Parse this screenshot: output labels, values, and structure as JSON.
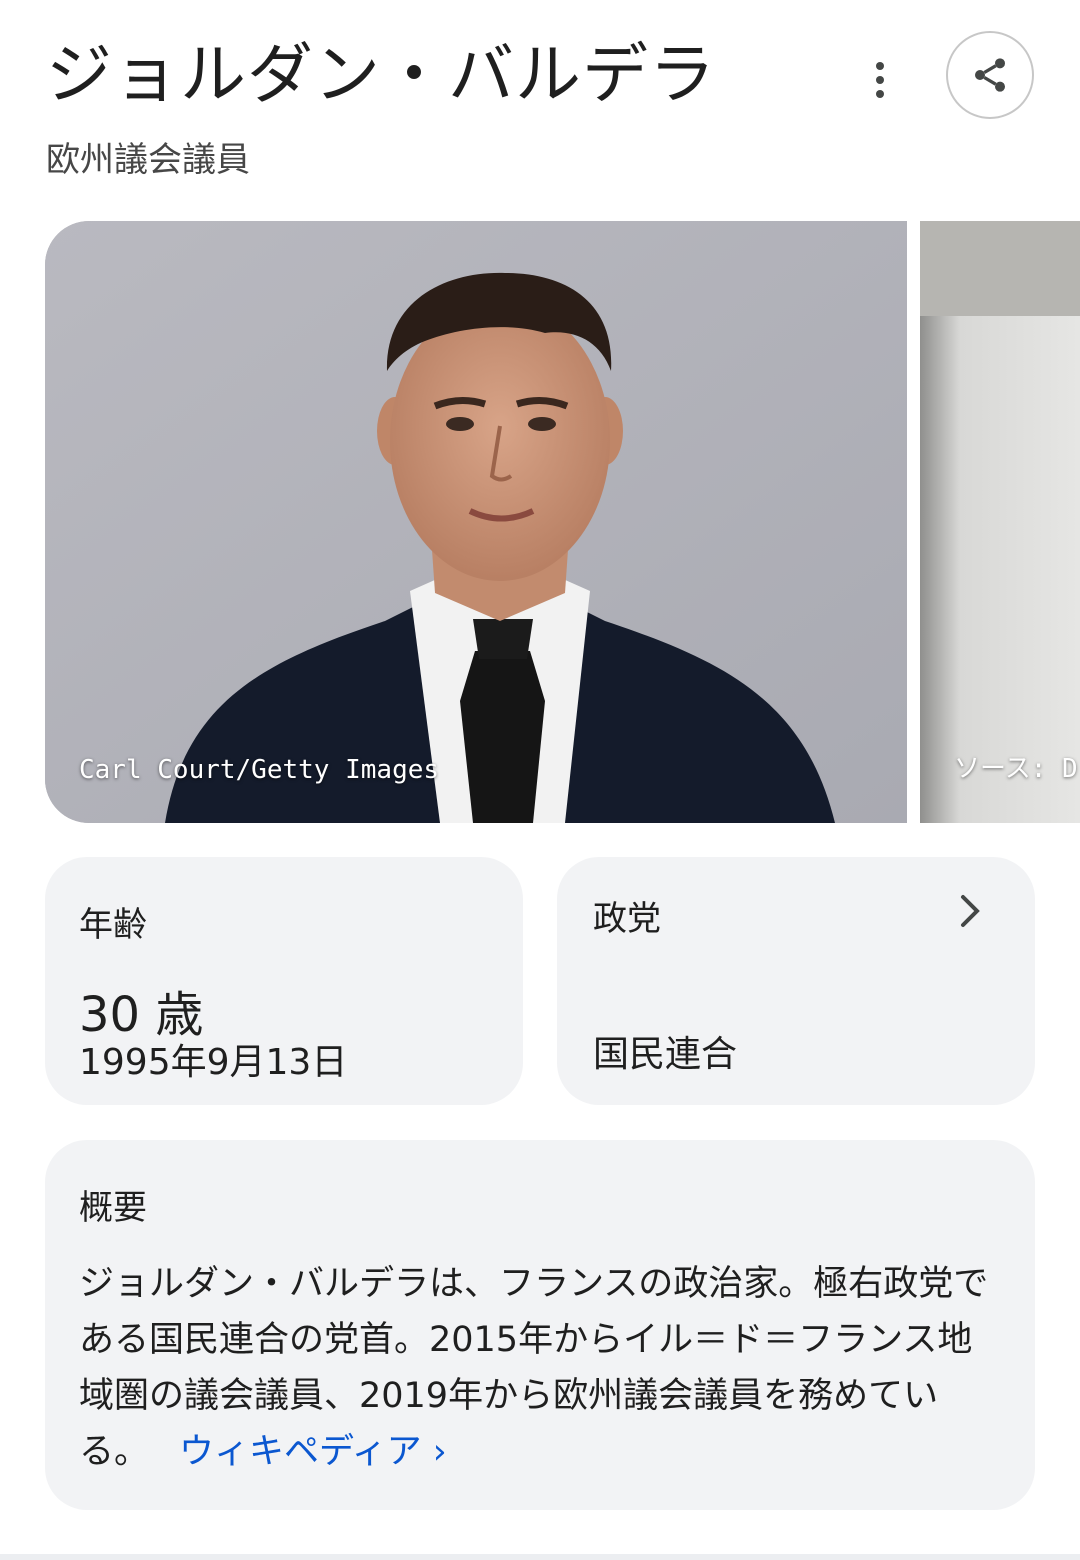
{
  "header": {
    "title": "ジョルダン・バルデラ",
    "subtitle": "欧州議会議員",
    "more_icon": "more-vert-icon",
    "share_icon": "share-icon"
  },
  "images": [
    {
      "credit": "Carl Court/Getty Images"
    },
    {
      "credit": "ソース: D"
    }
  ],
  "age_card": {
    "label": "年齢",
    "value": "30 歳",
    "birth_date": "1995年9月13日"
  },
  "party_card": {
    "label": "政党",
    "value": "国民連合",
    "icon": "chevron-right-icon"
  },
  "summary": {
    "label": "概要",
    "text": "ジョルダン・バルデラは、フランスの政治家。極右政党である国民連合の党首。2015年からイル＝ド＝フランス地域圏の議会議員、2019年から欧州議会議員を務めている。",
    "link_label": "ウィキペディア ›"
  },
  "colors": {
    "link": "#0b57d0",
    "card_bg": "#f2f3f5",
    "text": "#1f1f1f",
    "secondary_text": "#474747"
  }
}
